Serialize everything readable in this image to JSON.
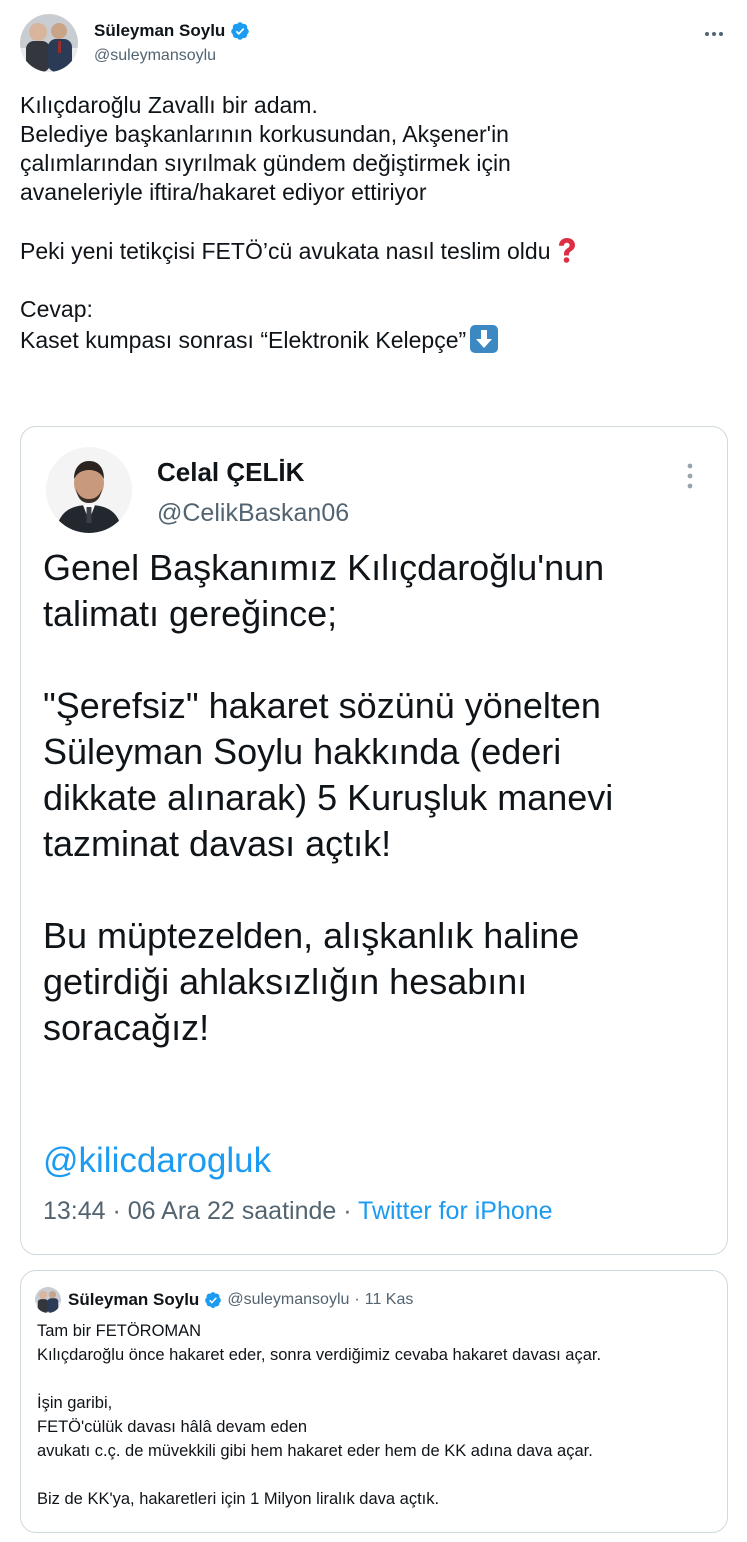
{
  "tweet": {
    "author_name": "Süleyman Soylu",
    "author_handle": "@suleymansoylu",
    "text_lines": [
      "Kılıçdaroğlu Zavallı bir adam.",
      "Belediye başkanlarının korkusundan, Akşener'in",
      "çalımlarından sıyrılmak gündem değiştirmek için",
      "avaneleriyle iftira/hakaret ediyor ettiriyor",
      "Peki yeni tetikçisi FETÖ’cü avukata nasıl teslim oldu",
      "Cevap:",
      "Kaset kumpası sonrası “Elektronik Kelepçe”"
    ],
    "icons": {
      "verified": "verified-badge-icon",
      "more": "more-options-icon",
      "question_emoji": "red-question-mark-icon",
      "down_emoji": "down-arrow-button-icon"
    },
    "colors": {
      "verified_blue": "#1d9bf0",
      "link_blue": "#1d9bf0",
      "secondary_text": "#536471",
      "border": "#cfd9de"
    }
  },
  "image_card": {
    "author_name": "Celal ÇELİK",
    "author_handle": "@CelikBaskan06",
    "body_lines": [
      "Genel Başkanımız Kılıçdaroğlu'nun",
      "talimatı gereğince;",
      "\"Şerefsiz\" hakaret sözünü yönelten",
      "Süleyman Soylu hakkında (ederi",
      "dikkate alınarak) 5 Kuruşluk manevi",
      "tazminat davası açtık!",
      "Bu müptezelden, alışkanlık haline",
      "getirdiği ahlaksızlığın hesabını",
      "soracağız!"
    ],
    "mention": "@kilicdarogluk",
    "meta_time": "13:44 · 06 Ara 22 saatinde · ",
    "meta_source": "Twitter for iPhone"
  },
  "quoted_tweet": {
    "author_name": "Süleyman Soylu",
    "author_handle": "@suleymansoylu",
    "separator": "·",
    "date": "11 Kas",
    "text_lines": [
      "Tam bir FETÖROMAN",
      "Kılıçdaroğlu önce hakaret eder, sonra verdiğimiz cevaba hakaret davası açar.",
      "İşin garibi,",
      "FETÖ'cülük davası hâlâ devam eden",
      "avukatı c.ç. de müvekkili gibi hem hakaret eder hem de KK adına dava açar.",
      "Biz de KK'ya, hakaretleri için 1 Milyon liralık dava açtık."
    ]
  }
}
